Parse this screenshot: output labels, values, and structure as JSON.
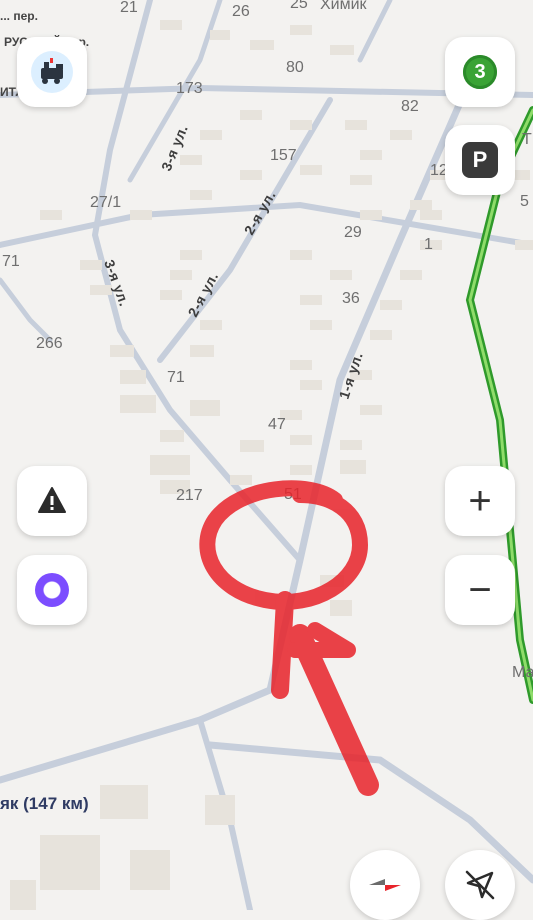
{
  "map": {
    "house_numbers": [
      "21",
      "26",
      "25",
      "80",
      "173",
      "82",
      "157",
      "27/1",
      "29",
      "1",
      "71",
      "36",
      "266",
      "71",
      "47",
      "217",
      "51"
    ],
    "streets": [
      "3-я ул.",
      "2-я ул.",
      "2-я ул.",
      "3-я ул.",
      "1-я ул."
    ],
    "top_labels": [
      "... пер.",
      "Химик",
      "РУССКИЙ пер.",
      "ИТЛ"
    ],
    "route_label": "як (147 км)",
    "edge_labels": [
      "Т",
      "5",
      "Ма",
      "12"
    ],
    "colors": {
      "background": "#f3f2f0",
      "road": "#c9d0dc",
      "building": "#e7e3dc",
      "traffic_green": "#3fb53a",
      "annotation_red": "#e8232a"
    }
  },
  "controls": {
    "left_top_icon": "train-station-icon",
    "traffic_level": "3",
    "parking_label": "P",
    "report_icon": "road-event-warning-icon",
    "alice_icon": "alice-voice-assistant-icon",
    "zoom_in": "+",
    "zoom_out": "−",
    "compass_icon": "compass-icon",
    "location_icon": "location-arrow-off-icon"
  }
}
